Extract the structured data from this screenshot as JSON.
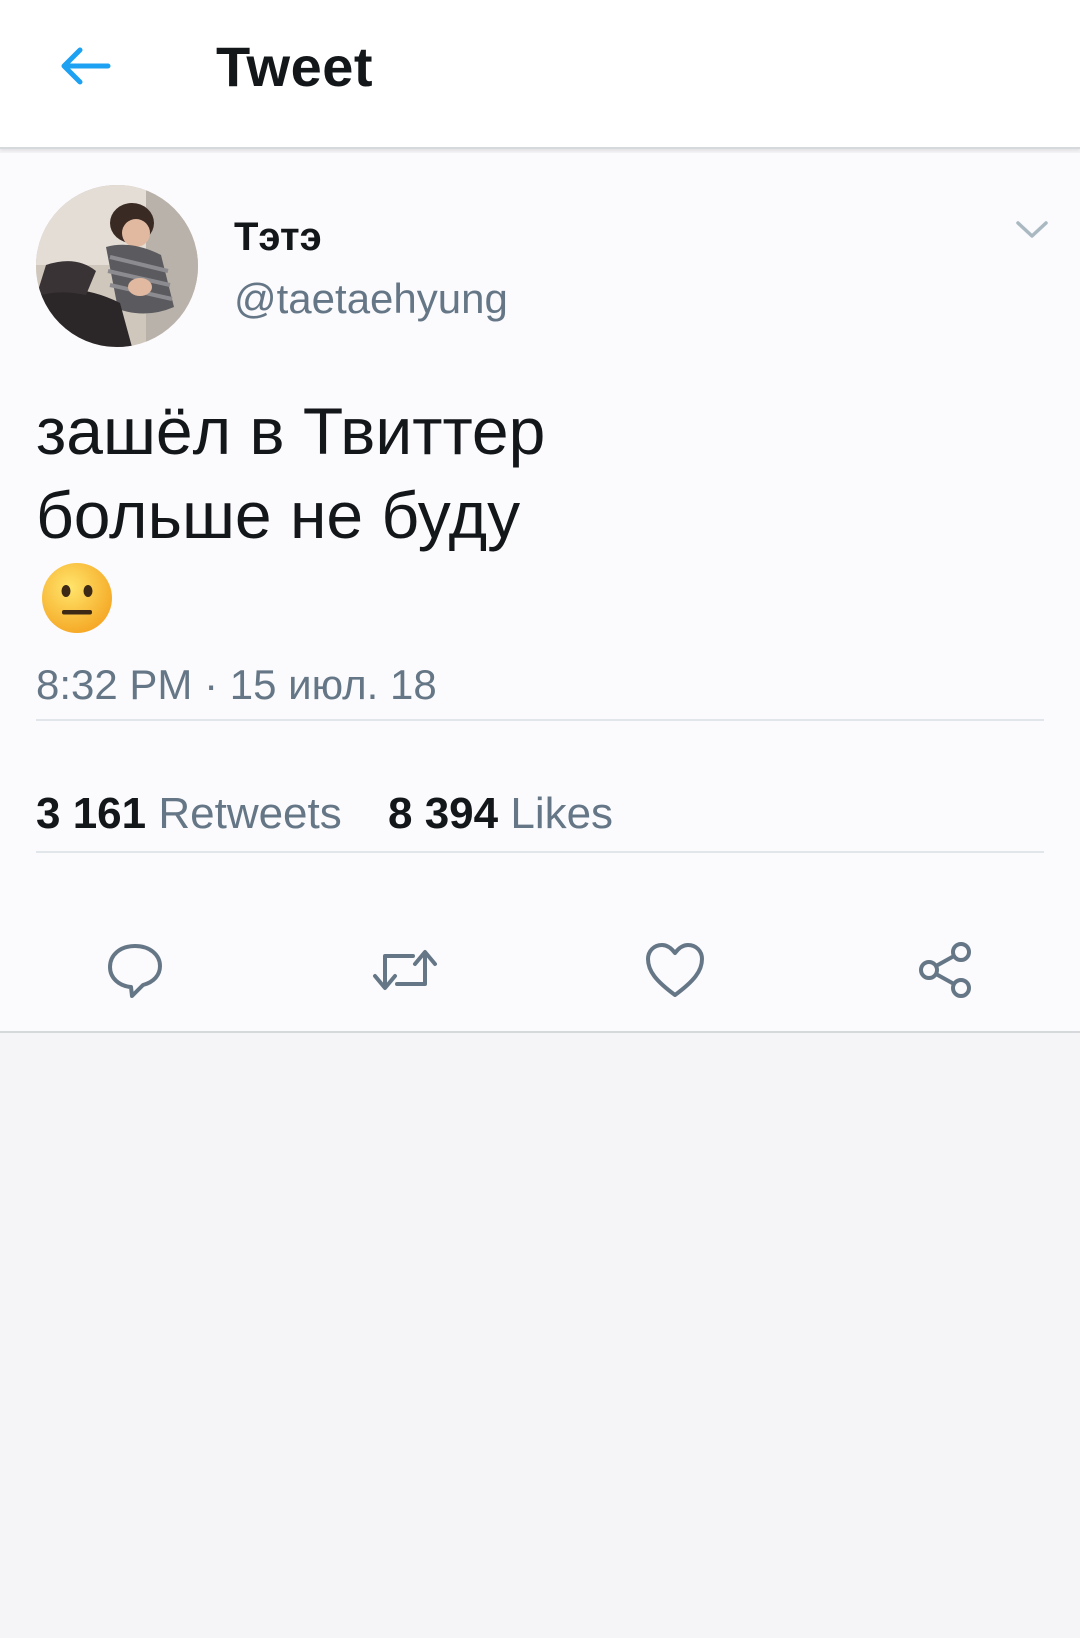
{
  "header": {
    "title": "Tweet",
    "back_icon": "arrow-left-icon",
    "accent_color": "#1da1f2"
  },
  "tweet": {
    "author": {
      "display_name": "Тэтэ",
      "handle": "@taetaehyung"
    },
    "text_lines": [
      "зашёл в Твиттер",
      "больше не буду"
    ],
    "emoji": "neutral-face",
    "timestamp": "8:32 PM · 15 июл. 18",
    "stats": {
      "retweets_count": "3 161",
      "retweets_label": "Retweets",
      "likes_count": "8 394",
      "likes_label": "Likes"
    },
    "actions": [
      "reply-icon",
      "retweet-icon",
      "like-icon",
      "share-icon"
    ]
  }
}
